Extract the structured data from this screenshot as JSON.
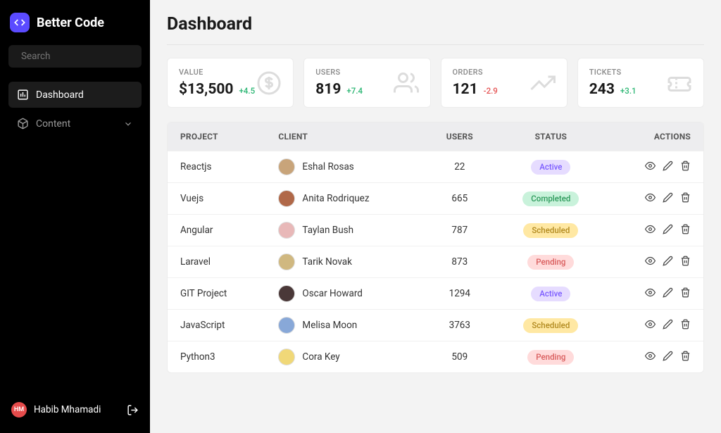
{
  "app": {
    "name": "Better Code"
  },
  "search": {
    "placeholder": "Search"
  },
  "nav": {
    "dashboard": "Dashboard",
    "content": "Content"
  },
  "user": {
    "initials": "HM",
    "name": "Habib Mhamadi"
  },
  "page": {
    "title": "Dashboard"
  },
  "cards": [
    {
      "label": "VALUE",
      "value": "$13,500",
      "delta": "+4.5",
      "deltaDir": "up",
      "icon": "dollar"
    },
    {
      "label": "USERS",
      "value": "819",
      "delta": "+7.4",
      "deltaDir": "up",
      "icon": "users"
    },
    {
      "label": "ORDERS",
      "value": "121",
      "delta": "-2.9",
      "deltaDir": "down",
      "icon": "trend"
    },
    {
      "label": "TICKETS",
      "value": "243",
      "delta": "+3.1",
      "deltaDir": "up",
      "icon": "ticket"
    }
  ],
  "table": {
    "headers": [
      "PROJECT",
      "CLIENT",
      "USERS",
      "STATUS",
      "ACTIONS"
    ],
    "rows": [
      {
        "project": "Reactjs",
        "client": "Eshal Rosas",
        "users": "22",
        "status": "Active",
        "statusClass": "active",
        "av": "#c8a47a"
      },
      {
        "project": "Vuejs",
        "client": "Anita Rodriquez",
        "users": "665",
        "status": "Completed",
        "statusClass": "completed",
        "av": "#b06848"
      },
      {
        "project": "Angular",
        "client": "Taylan Bush",
        "users": "787",
        "status": "Scheduled",
        "statusClass": "scheduled",
        "av": "#e8b8b8"
      },
      {
        "project": "Laravel",
        "client": "Tarik Novak",
        "users": "873",
        "status": "Pending",
        "statusClass": "pending",
        "av": "#d0b880"
      },
      {
        "project": "GIT Project",
        "client": "Oscar Howard",
        "users": "1294",
        "status": "Active",
        "statusClass": "active",
        "av": "#4a3838"
      },
      {
        "project": "JavaScript",
        "client": "Melisa Moon",
        "users": "3763",
        "status": "Scheduled",
        "statusClass": "scheduled",
        "av": "#88a8d8"
      },
      {
        "project": "Python3",
        "client": "Cora Key",
        "users": "509",
        "status": "Pending",
        "statusClass": "pending",
        "av": "#f0d878"
      }
    ]
  }
}
